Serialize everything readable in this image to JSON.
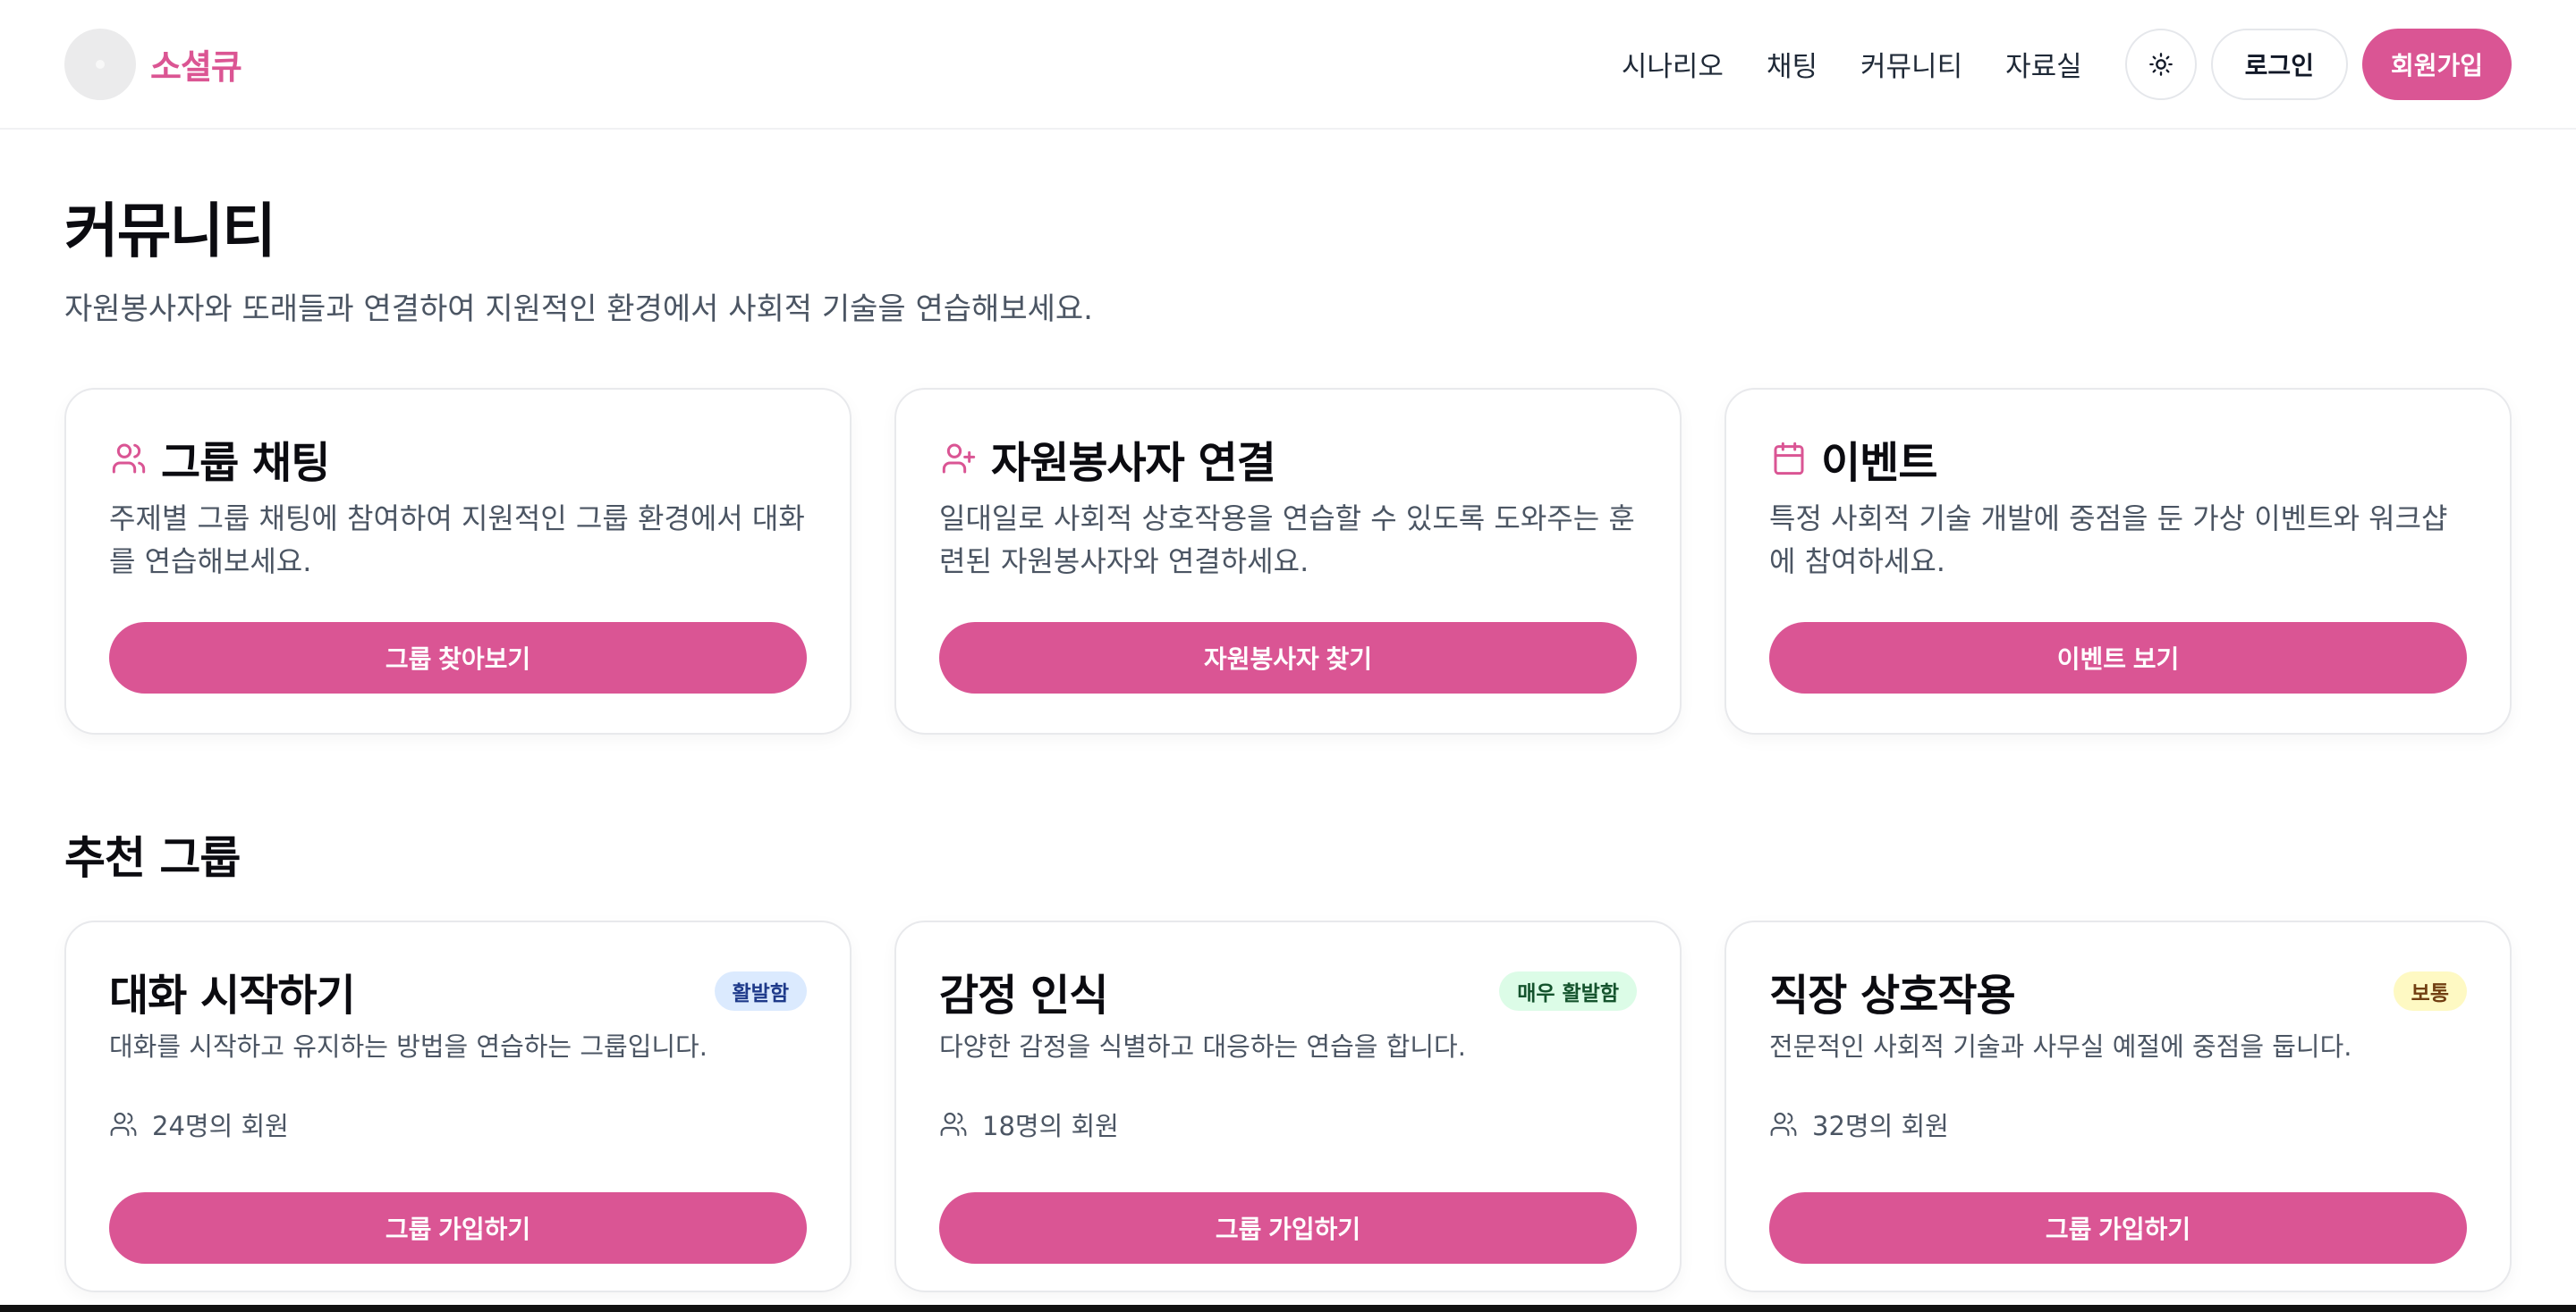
{
  "brand": {
    "name": "소셜큐"
  },
  "nav": {
    "links": [
      "시나리오",
      "채팅",
      "커뮤니티",
      "자료실"
    ],
    "login": "로그인",
    "signup": "회원가입",
    "theme_icon": "sun-icon"
  },
  "intro": {
    "title": "커뮤니티",
    "description": "자원봉사자와 또래들과 연결하여 지원적인 환경에서 사회적 기술을 연습해보세요."
  },
  "features": [
    {
      "icon": "users-icon",
      "title": "그룹 채팅",
      "description": "주제별 그룹 채팅에 참여하여 지원적인 그룹 환경에서 대화를 연습해보세요.",
      "button": "그룹 찾아보기"
    },
    {
      "icon": "user-plus-icon",
      "title": "자원봉사자 연결",
      "description": "일대일로 사회적 상호작용을 연습할 수 있도록 도와주는 훈련된 자원봉사자와 연결하세요.",
      "button": "자원봉사자 찾기"
    },
    {
      "icon": "calendar-icon",
      "title": "이벤트",
      "description": "특정 사회적 기술 개발에 중점을 둔 가상 이벤트와 워크샵에 참여하세요.",
      "button": "이벤트 보기"
    }
  ],
  "recommended": {
    "title": "추천 그룹",
    "groups": [
      {
        "name": "대화 시작하기",
        "badge": "활발함",
        "description": "대화를 시작하고 유지하는 방법을 연습하는 그룹입니다.",
        "members": "24명의 회원",
        "button": "그룹 가입하기"
      },
      {
        "name": "감정 인식",
        "badge": "매우 활발함",
        "description": "다양한 감정을 식별하고 대응하는 연습을 합니다.",
        "members": "18명의 회원",
        "button": "그룹 가입하기"
      },
      {
        "name": "직장 상호작용",
        "badge": "보통",
        "description": "전문적인 사회적 기술과 사무실 예절에 중점을 둡니다.",
        "members": "32명의 회원",
        "button": "그룹 가입하기"
      }
    ]
  },
  "colors": {
    "accent": "#da5594",
    "text": "#111827",
    "muted": "#4b5563"
  }
}
